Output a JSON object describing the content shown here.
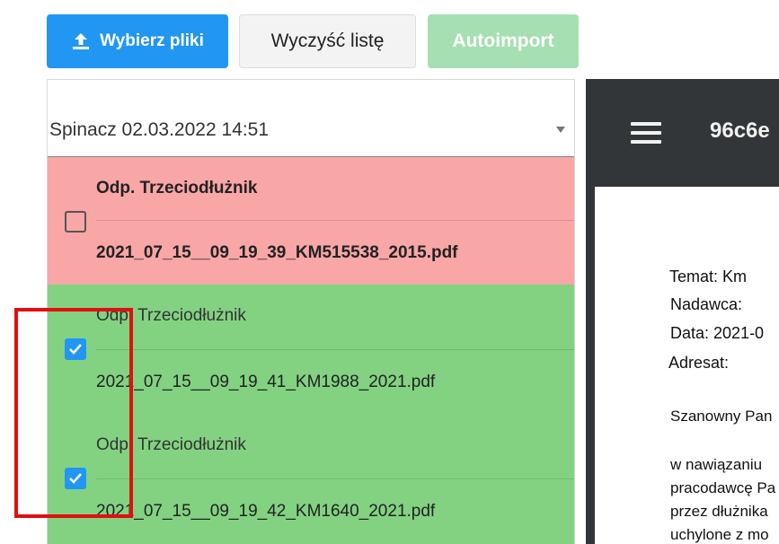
{
  "toolbar": {
    "upload_label": "Wybierz pliki",
    "clear_label": "Wyczyść listę",
    "autoimport_label": "Autoimport"
  },
  "select": {
    "value": "Spinacz 02.03.2022 14:51"
  },
  "files": [
    {
      "title": "Odp. Trzeciodłużnik",
      "filename": "2021_07_15__09_19_39_KM515538_2015.pdf",
      "status": "error",
      "checked": false
    },
    {
      "title": "Odp. Trzeciodłużnik",
      "filename": "2021_07_15__09_19_41_KM1988_2021.pdf",
      "status": "ok",
      "checked": true
    },
    {
      "title": "Odp. Trzeciodłużnik",
      "filename": "2021_07_15__09_19_42_KM1640_2021.pdf",
      "status": "ok",
      "checked": true
    }
  ],
  "viewer": {
    "doc_name": "96c6e",
    "lines": [
      "Temat: Km",
      "Nadawca:",
      "Data: 2021-0",
      "Adresat:",
      "Szanowny Pan",
      "w nawiązaniu",
      "pracodawcę Pa",
      "przez dłużnika",
      "uchylone z mo"
    ]
  },
  "colors": {
    "primary": "#2196f3",
    "error_row": "#f9a6a6",
    "ok_row": "#82d282",
    "autoimport_disabled": "#a6dfb2",
    "viewer_bg": "#323639",
    "highlight": "#e01010"
  }
}
